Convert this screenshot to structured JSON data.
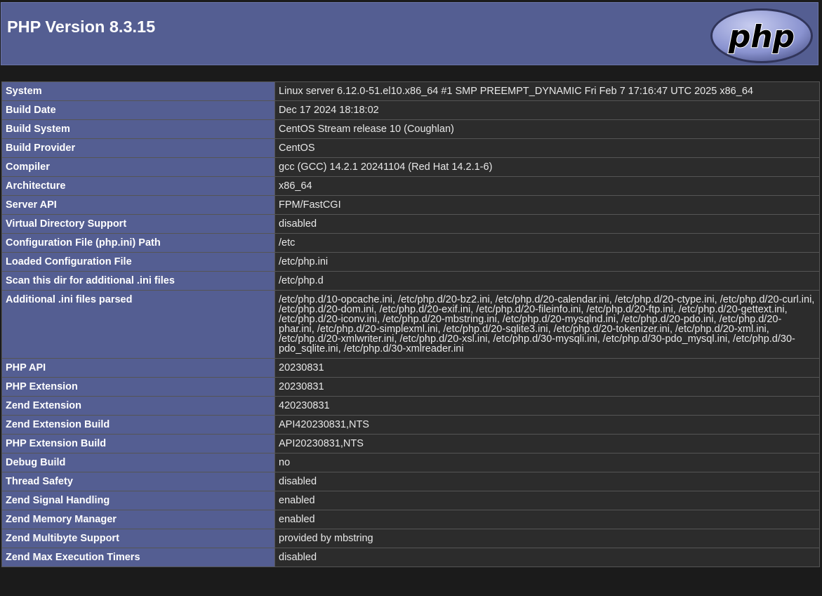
{
  "header": {
    "title": "PHP Version 8.3.15",
    "logo_text": "php"
  },
  "rows": [
    {
      "label": "System",
      "value": "Linux server 6.12.0-51.el10.x86_64 #1 SMP PREEMPT_DYNAMIC Fri Feb 7 17:16:47 UTC 2025 x86_64"
    },
    {
      "label": "Build Date",
      "value": "Dec 17 2024 18:18:02"
    },
    {
      "label": "Build System",
      "value": "CentOS Stream release 10 (Coughlan)"
    },
    {
      "label": "Build Provider",
      "value": "CentOS"
    },
    {
      "label": "Compiler",
      "value": "gcc (GCC) 14.2.1 20241104 (Red Hat 14.2.1-6)"
    },
    {
      "label": "Architecture",
      "value": "x86_64"
    },
    {
      "label": "Server API",
      "value": "FPM/FastCGI"
    },
    {
      "label": "Virtual Directory Support",
      "value": "disabled"
    },
    {
      "label": "Configuration File (php.ini) Path",
      "value": "/etc"
    },
    {
      "label": "Loaded Configuration File",
      "value": "/etc/php.ini"
    },
    {
      "label": "Scan this dir for additional .ini files",
      "value": "/etc/php.d"
    },
    {
      "label": "Additional .ini files parsed",
      "value": "/etc/php.d/10-opcache.ini, /etc/php.d/20-bz2.ini, /etc/php.d/20-calendar.ini, /etc/php.d/20-ctype.ini, /etc/php.d/20-curl.ini, /etc/php.d/20-dom.ini, /etc/php.d/20-exif.ini, /etc/php.d/20-fileinfo.ini, /etc/php.d/20-ftp.ini, /etc/php.d/20-gettext.ini, /etc/php.d/20-iconv.ini, /etc/php.d/20-mbstring.ini, /etc/php.d/20-mysqlnd.ini, /etc/php.d/20-pdo.ini, /etc/php.d/20-phar.ini, /etc/php.d/20-simplexml.ini, /etc/php.d/20-sqlite3.ini, /etc/php.d/20-tokenizer.ini, /etc/php.d/20-xml.ini, /etc/php.d/20-xmlwriter.ini, /etc/php.d/20-xsl.ini, /etc/php.d/30-mysqli.ini, /etc/php.d/30-pdo_mysql.ini, /etc/php.d/30-pdo_sqlite.ini, /etc/php.d/30-xmlreader.ini"
    },
    {
      "label": "PHP API",
      "value": "20230831"
    },
    {
      "label": "PHP Extension",
      "value": "20230831"
    },
    {
      "label": "Zend Extension",
      "value": "420230831"
    },
    {
      "label": "Zend Extension Build",
      "value": "API420230831,NTS"
    },
    {
      "label": "PHP Extension Build",
      "value": "API20230831,NTS"
    },
    {
      "label": "Debug Build",
      "value": "no"
    },
    {
      "label": "Thread Safety",
      "value": "disabled"
    },
    {
      "label": "Zend Signal Handling",
      "value": "enabled"
    },
    {
      "label": "Zend Memory Manager",
      "value": "enabled"
    },
    {
      "label": "Zend Multibyte Support",
      "value": "provided by mbstring"
    },
    {
      "label": "Zend Max Execution Timers",
      "value": "disabled"
    }
  ],
  "colors": {
    "header_bg": "#545e92",
    "key_bg": "#545e92",
    "value_bg": "#2c2c2c",
    "page_bg": "#1b1b1b"
  }
}
